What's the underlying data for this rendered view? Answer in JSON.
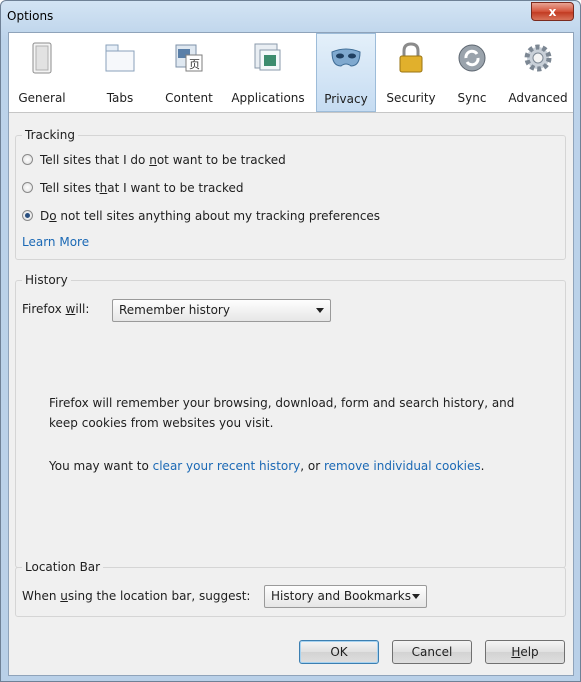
{
  "window": {
    "title": "Options",
    "close_label": "x"
  },
  "toolbar": {
    "items": [
      {
        "label": "General"
      },
      {
        "label": "Tabs"
      },
      {
        "label": "Content"
      },
      {
        "label": "Applications"
      },
      {
        "label": "Privacy"
      },
      {
        "label": "Security"
      },
      {
        "label": "Sync"
      },
      {
        "label": "Advanced"
      }
    ],
    "selected": "Privacy"
  },
  "tracking": {
    "legend": "Tracking",
    "options": [
      {
        "pre": "Tell sites that I do ",
        "u": "n",
        "post": "ot want to be tracked",
        "selected": false
      },
      {
        "pre": "Tell sites t",
        "u": "h",
        "post": "at I want to be tracked",
        "selected": false
      },
      {
        "pre": "D",
        "u": "o",
        "post": " not tell sites anything about my tracking preferences",
        "selected": true
      }
    ],
    "learn_more": "Learn More"
  },
  "history": {
    "legend": "History",
    "label_pre": "Firefox ",
    "label_u": "w",
    "label_post": "ill:",
    "select_value": "Remember history",
    "description": "Firefox will remember your browsing, download, form and search history, and keep cookies from websites you visit.",
    "hint_pre": "You may want to ",
    "hint_link1": "clear your recent history",
    "hint_mid": ", or ",
    "hint_link2": "remove individual cookies",
    "hint_post": "."
  },
  "location_bar": {
    "legend": "Location Bar",
    "label_pre": "When ",
    "label_u": "u",
    "label_post": "sing the location bar, suggest:",
    "select_value": "History and Bookmarks"
  },
  "buttons": {
    "ok": "OK",
    "cancel": "Cancel",
    "help_u": "H",
    "help_post": "elp"
  }
}
